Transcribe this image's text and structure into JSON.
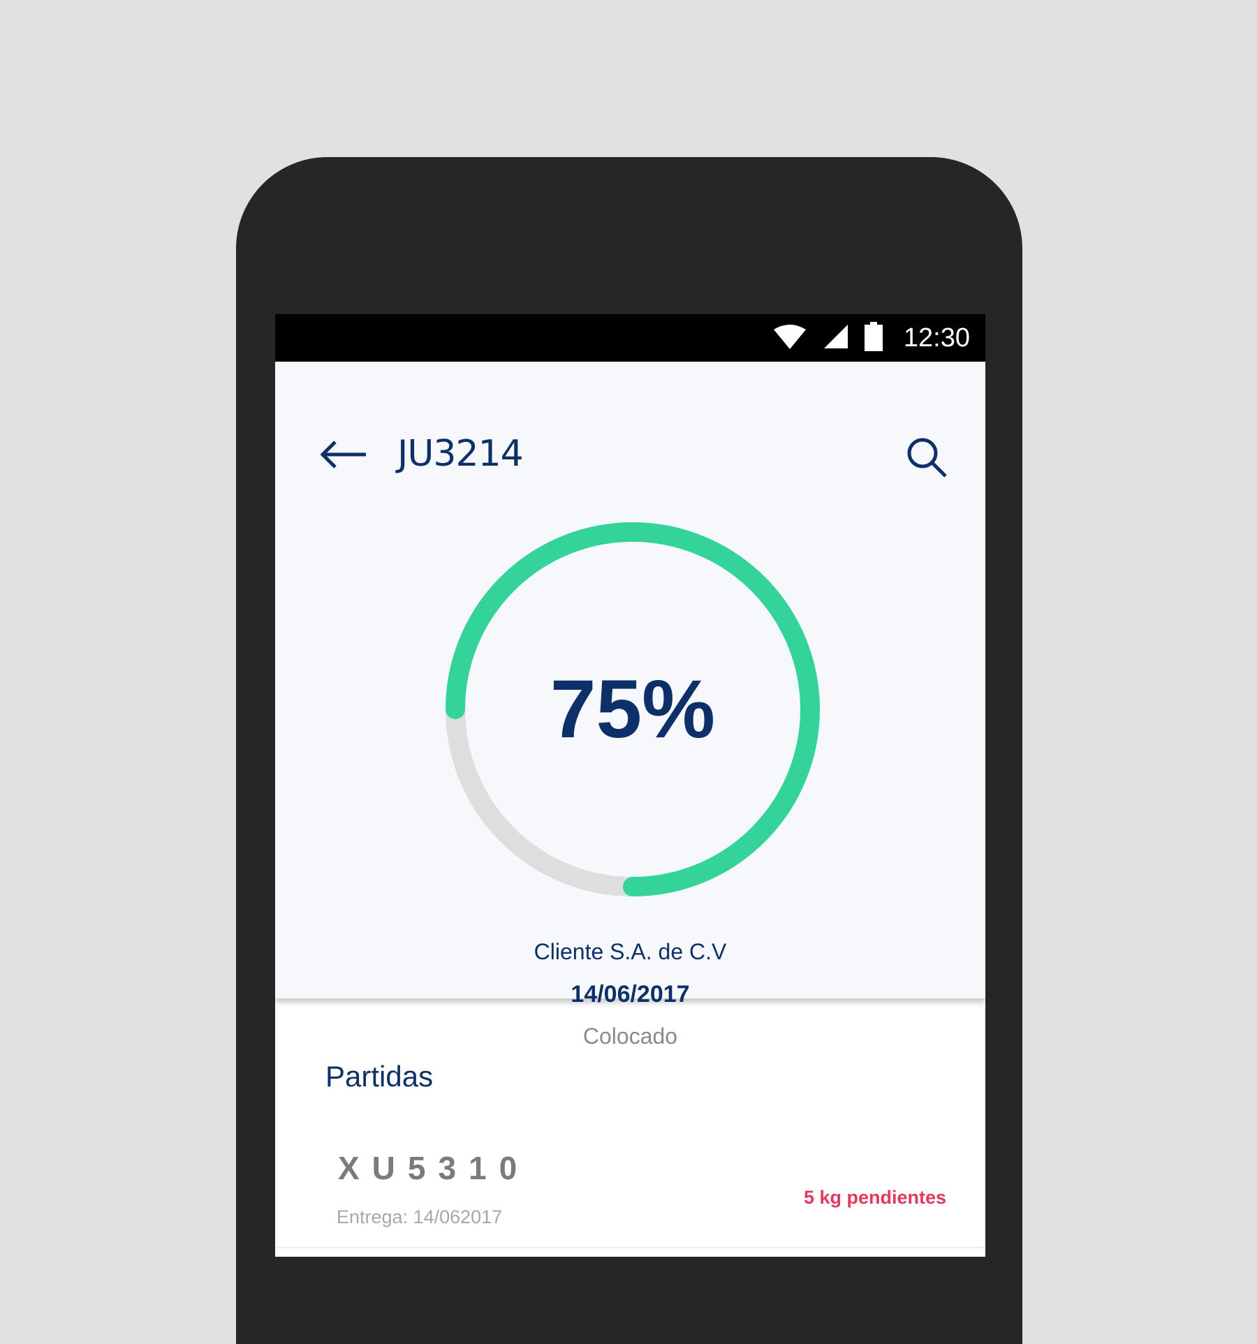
{
  "status_bar": {
    "time": "12:30",
    "icons": [
      "wifi-icon",
      "signal-icon",
      "battery-icon"
    ]
  },
  "header": {
    "title": "JU3214",
    "back_icon": "arrow-left-icon",
    "search_icon": "search-icon"
  },
  "progress": {
    "label": "75%",
    "value": 0.75,
    "fill_color": "#34d399",
    "track_color": "#dedede"
  },
  "order": {
    "client": "Cliente S.A. de C.V",
    "date": "14/06/2017",
    "status": "Colocado"
  },
  "items_section": {
    "title": "Partidas",
    "items": [
      {
        "code": "XU5310",
        "delivery": "Entrega: 14/062017",
        "pending": "5 kg pendientes"
      }
    ]
  },
  "colors": {
    "primary": "#0e3068",
    "accent": "#34d399",
    "alert": "#e3395f",
    "background": "#f6f8fb"
  }
}
